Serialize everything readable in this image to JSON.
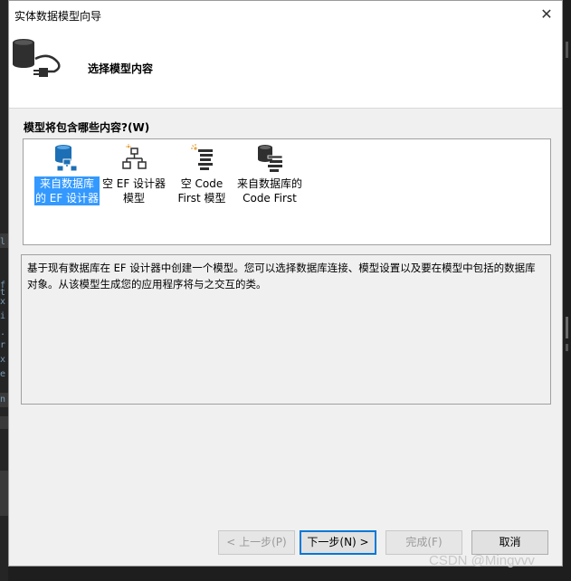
{
  "window": {
    "title": "实体数据模型向导",
    "close_glyph": "✕"
  },
  "header": {
    "step_title": "选择模型内容"
  },
  "content": {
    "question_label": "模型将包含哪些内容?",
    "question_mnemonic": "(W)",
    "options": [
      {
        "line1": "来自数据库",
        "line2": "的 EF 设计器",
        "icon": "database-designer-icon",
        "selected": true
      },
      {
        "line1": "空 EF 设计器",
        "line2": "模型",
        "icon": "empty-designer-icon",
        "selected": false
      },
      {
        "line1": "空 Code",
        "line2": "First 模型",
        "icon": "empty-code-first-icon",
        "selected": false
      },
      {
        "line1": "来自数据库的",
        "line2": "Code First",
        "icon": "database-code-first-icon",
        "selected": false
      }
    ],
    "description": "基于现有数据库在 EF 设计器中创建一个模型。您可以选择数据库连接、模型设置以及要在模型中包括的数据库对象。从该模型生成您的应用程序将与之交互的类。"
  },
  "buttons": {
    "prev": "< 上一步(P)",
    "next": "下一步(N) >",
    "finish": "完成(F)",
    "cancel": "取消"
  },
  "watermark": "CSDN @Mingvvv",
  "ide_left_chars": [
    "l",
    "f",
    "t",
    "x",
    "i",
    ".",
    "r",
    "x",
    "e",
    "n"
  ],
  "colors": {
    "selection": "#3399ff",
    "accent_blue": "#1c6fb4",
    "orange": "#e8a33d"
  }
}
